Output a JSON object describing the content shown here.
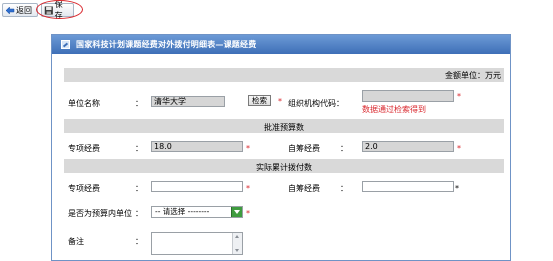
{
  "toolbar": {
    "back_label": "返回",
    "save_label": "保存"
  },
  "panel": {
    "title": "国家科技计划课题经费对外拨付明细表—课题经费",
    "amount_unit": "金额单位：万元"
  },
  "form": {
    "unit_name_label": "单位名称",
    "unit_name_value": "清华大学",
    "search_button": "检索",
    "org_code_label": "组织机构代码：",
    "org_code_value": "",
    "org_code_hint": "数据通过检索得到",
    "colon": "：",
    "star": "*",
    "approved_budget_section": "批准预算数",
    "special_funds_label": "专项经费",
    "special_funds_value": "18.0",
    "self_funds_label": "自筹经费",
    "self_funds_value": "2.0",
    "actual_section": "实际累计拨付数",
    "actual_special_label": "专项经费",
    "actual_special_value": "",
    "actual_self_label": "自筹经费",
    "actual_self_value": "",
    "in_budget_label": "是否为预算内单位",
    "in_budget_select": "-- 请选择 --------",
    "remark_label": "备注"
  },
  "colors": {
    "header_bg": "#4f7fc4",
    "required_star": "#d9262c",
    "section_bg": "#d9d9d9",
    "readonly_bg": "#d6d6d6"
  }
}
